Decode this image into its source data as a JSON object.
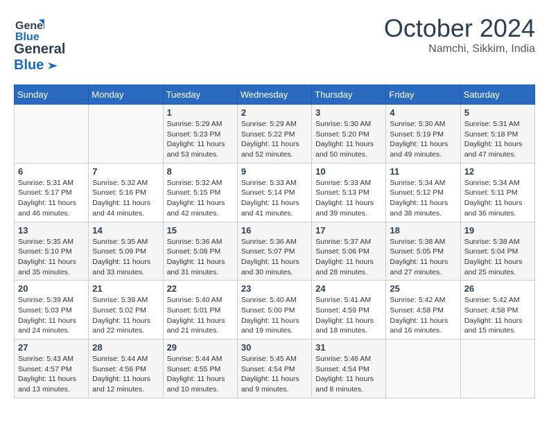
{
  "header": {
    "logo_line1": "General",
    "logo_line2": "Blue",
    "month": "October 2024",
    "location": "Namchi, Sikkim, India"
  },
  "weekdays": [
    "Sunday",
    "Monday",
    "Tuesday",
    "Wednesday",
    "Thursday",
    "Friday",
    "Saturday"
  ],
  "weeks": [
    [
      {
        "day": "",
        "info": ""
      },
      {
        "day": "",
        "info": ""
      },
      {
        "day": "1",
        "info": "Sunrise: 5:29 AM\nSunset: 5:23 PM\nDaylight: 11 hours and 53 minutes."
      },
      {
        "day": "2",
        "info": "Sunrise: 5:29 AM\nSunset: 5:22 PM\nDaylight: 11 hours and 52 minutes."
      },
      {
        "day": "3",
        "info": "Sunrise: 5:30 AM\nSunset: 5:20 PM\nDaylight: 11 hours and 50 minutes."
      },
      {
        "day": "4",
        "info": "Sunrise: 5:30 AM\nSunset: 5:19 PM\nDaylight: 11 hours and 49 minutes."
      },
      {
        "day": "5",
        "info": "Sunrise: 5:31 AM\nSunset: 5:18 PM\nDaylight: 11 hours and 47 minutes."
      }
    ],
    [
      {
        "day": "6",
        "info": "Sunrise: 5:31 AM\nSunset: 5:17 PM\nDaylight: 11 hours and 46 minutes."
      },
      {
        "day": "7",
        "info": "Sunrise: 5:32 AM\nSunset: 5:16 PM\nDaylight: 11 hours and 44 minutes."
      },
      {
        "day": "8",
        "info": "Sunrise: 5:32 AM\nSunset: 5:15 PM\nDaylight: 11 hours and 42 minutes."
      },
      {
        "day": "9",
        "info": "Sunrise: 5:33 AM\nSunset: 5:14 PM\nDaylight: 11 hours and 41 minutes."
      },
      {
        "day": "10",
        "info": "Sunrise: 5:33 AM\nSunset: 5:13 PM\nDaylight: 11 hours and 39 minutes."
      },
      {
        "day": "11",
        "info": "Sunrise: 5:34 AM\nSunset: 5:12 PM\nDaylight: 11 hours and 38 minutes."
      },
      {
        "day": "12",
        "info": "Sunrise: 5:34 AM\nSunset: 5:11 PM\nDaylight: 11 hours and 36 minutes."
      }
    ],
    [
      {
        "day": "13",
        "info": "Sunrise: 5:35 AM\nSunset: 5:10 PM\nDaylight: 11 hours and 35 minutes."
      },
      {
        "day": "14",
        "info": "Sunrise: 5:35 AM\nSunset: 5:09 PM\nDaylight: 11 hours and 33 minutes."
      },
      {
        "day": "15",
        "info": "Sunrise: 5:36 AM\nSunset: 5:08 PM\nDaylight: 11 hours and 31 minutes."
      },
      {
        "day": "16",
        "info": "Sunrise: 5:36 AM\nSunset: 5:07 PM\nDaylight: 11 hours and 30 minutes."
      },
      {
        "day": "17",
        "info": "Sunrise: 5:37 AM\nSunset: 5:06 PM\nDaylight: 11 hours and 28 minutes."
      },
      {
        "day": "18",
        "info": "Sunrise: 5:38 AM\nSunset: 5:05 PM\nDaylight: 11 hours and 27 minutes."
      },
      {
        "day": "19",
        "info": "Sunrise: 5:38 AM\nSunset: 5:04 PM\nDaylight: 11 hours and 25 minutes."
      }
    ],
    [
      {
        "day": "20",
        "info": "Sunrise: 5:39 AM\nSunset: 5:03 PM\nDaylight: 11 hours and 24 minutes."
      },
      {
        "day": "21",
        "info": "Sunrise: 5:39 AM\nSunset: 5:02 PM\nDaylight: 11 hours and 22 minutes."
      },
      {
        "day": "22",
        "info": "Sunrise: 5:40 AM\nSunset: 5:01 PM\nDaylight: 11 hours and 21 minutes."
      },
      {
        "day": "23",
        "info": "Sunrise: 5:40 AM\nSunset: 5:00 PM\nDaylight: 11 hours and 19 minutes."
      },
      {
        "day": "24",
        "info": "Sunrise: 5:41 AM\nSunset: 4:59 PM\nDaylight: 11 hours and 18 minutes."
      },
      {
        "day": "25",
        "info": "Sunrise: 5:42 AM\nSunset: 4:58 PM\nDaylight: 11 hours and 16 minutes."
      },
      {
        "day": "26",
        "info": "Sunrise: 5:42 AM\nSunset: 4:58 PM\nDaylight: 11 hours and 15 minutes."
      }
    ],
    [
      {
        "day": "27",
        "info": "Sunrise: 5:43 AM\nSunset: 4:57 PM\nDaylight: 11 hours and 13 minutes."
      },
      {
        "day": "28",
        "info": "Sunrise: 5:44 AM\nSunset: 4:56 PM\nDaylight: 11 hours and 12 minutes."
      },
      {
        "day": "29",
        "info": "Sunrise: 5:44 AM\nSunset: 4:55 PM\nDaylight: 11 hours and 10 minutes."
      },
      {
        "day": "30",
        "info": "Sunrise: 5:45 AM\nSunset: 4:54 PM\nDaylight: 11 hours and 9 minutes."
      },
      {
        "day": "31",
        "info": "Sunrise: 5:46 AM\nSunset: 4:54 PM\nDaylight: 11 hours and 8 minutes."
      },
      {
        "day": "",
        "info": ""
      },
      {
        "day": "",
        "info": ""
      }
    ]
  ]
}
